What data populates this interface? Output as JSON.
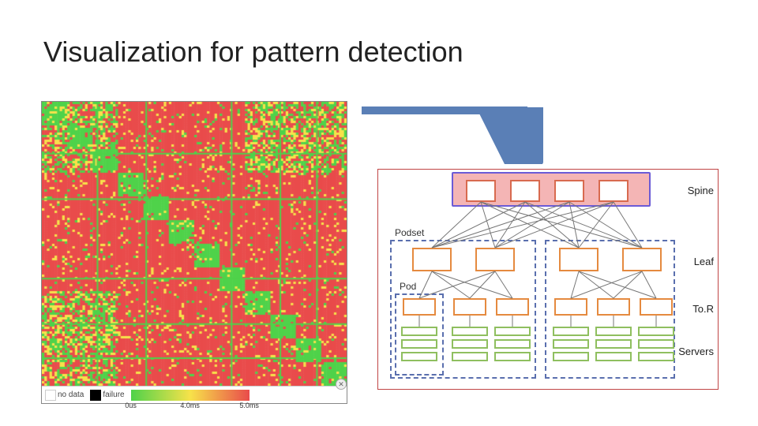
{
  "title": "Visualization for pattern detection",
  "heatmap": {
    "legend": {
      "no_data": "no data",
      "failure": "failure",
      "grad_min": "0us",
      "grad_mid": "4.0ms",
      "grad_max": "5.0ms"
    },
    "colors": {
      "no_data": "#ffffff",
      "failure": "#000000",
      "low": "#4fd24a",
      "mid": "#f7e24a",
      "high": "#e94b4b"
    },
    "grid_n": 120,
    "diag_block_count": 12
  },
  "topology": {
    "labels": {
      "spine": "Spine",
      "leaf": "Leaf",
      "tor": "To.R",
      "servers": "Servers",
      "podset": "Podset",
      "pod": "Pod"
    },
    "arrow_color": "#5a7fb6",
    "highlight_fill": "rgba(235,120,120,0.55)",
    "highlight_border": "#6b5bd6",
    "dash_color": "#5a6fae",
    "colors": {
      "spine": "#d86a4f",
      "leaf": "#e58a3f",
      "tor": "#e58a3f",
      "server": "#8fbf5f"
    },
    "counts": {
      "spine": 4,
      "leaf_per_podset": 2,
      "podsets": 2,
      "tor_per_pod": 1,
      "pods_visible": 4,
      "servers_per_tor": 3
    }
  }
}
